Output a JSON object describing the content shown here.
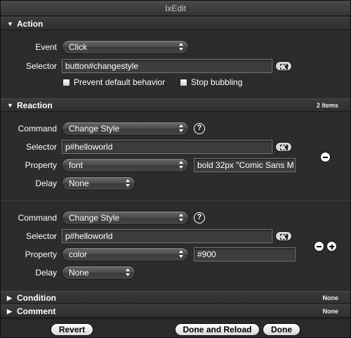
{
  "window": {
    "title": "IxEdit"
  },
  "action": {
    "header": "Action",
    "event_label": "Event",
    "event_value": "Click",
    "selector_label": "Selector",
    "selector_value": "button#changestyle",
    "prevent_default_label": "Prevent default behavior",
    "stop_bubbling_label": "Stop bubbling"
  },
  "reaction": {
    "header": "Reaction",
    "count": "2 Items",
    "items": [
      {
        "command_label": "Command",
        "command_value": "Change Style",
        "selector_label": "Selector",
        "selector_value": "p#helloworld",
        "property_label": "Property",
        "property_value": "font",
        "property_text": "bold 32px \"Comic Sans M",
        "delay_label": "Delay",
        "delay_value": "None"
      },
      {
        "command_label": "Command",
        "command_value": "Change Style",
        "selector_label": "Selector",
        "selector_value": "p#helloworld",
        "property_label": "Property",
        "property_value": "color",
        "property_text": "#900",
        "delay_label": "Delay",
        "delay_value": "None"
      }
    ]
  },
  "condition": {
    "header": "Condition",
    "value": "None"
  },
  "comment": {
    "header": "Comment",
    "value": "None"
  },
  "help_glyph": "?",
  "footer": {
    "revert": "Revert",
    "done_reload": "Done and Reload",
    "done": "Done"
  },
  "icons": {
    "expanded": "disclosure-down-icon",
    "collapsed": "disclosure-right-icon"
  }
}
